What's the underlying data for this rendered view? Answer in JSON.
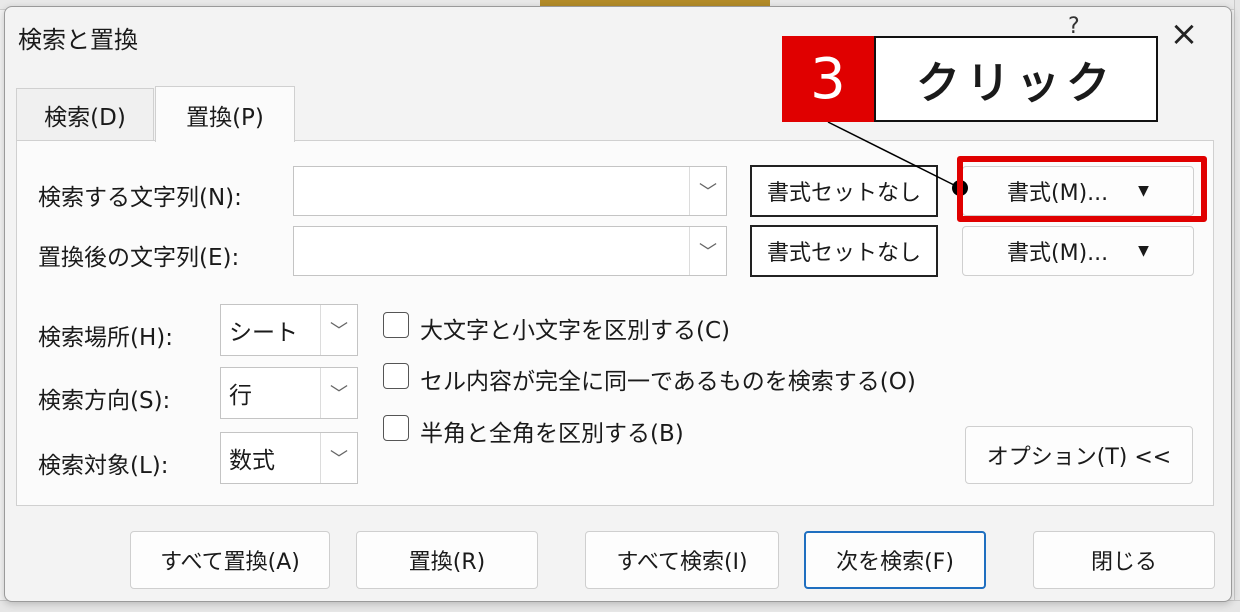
{
  "dialog": {
    "title": "検索と置換",
    "help": "?",
    "close": "×"
  },
  "tabs": [
    {
      "label": "検索(D)",
      "selected": false
    },
    {
      "label": "置換(P)",
      "selected": true
    }
  ],
  "find": {
    "label": "検索する文字列(N):",
    "value": "",
    "no_format_label": "書式セットなし",
    "format_label": "書式(M)..."
  },
  "replace": {
    "label": "置換後の文字列(E):",
    "value": "",
    "no_format_label": "書式セットなし",
    "format_label": "書式(M)..."
  },
  "options": {
    "within_label": "検索場所(H):",
    "within_value": "シート",
    "search_label": "検索方向(S):",
    "search_value": "行",
    "lookin_label": "検索対象(L):",
    "lookin_value": "数式",
    "checkboxes": [
      {
        "label": "大文字と小文字を区別する(C)",
        "checked": false
      },
      {
        "label": "セル内容が完全に同一であるものを検索する(O)",
        "checked": false
      },
      {
        "label": "半角と全角を区別する(B)",
        "checked": false
      }
    ],
    "options_button": "オプション(T) <<"
  },
  "buttons": {
    "replace_all": "すべて置換(A)",
    "replace": "置換(R)",
    "find_all": "すべて検索(I)",
    "find_next": "次を検索(F)",
    "close": "閉じる"
  },
  "annotation": {
    "step": "3",
    "text": "クリック",
    "color": "#e00000"
  }
}
